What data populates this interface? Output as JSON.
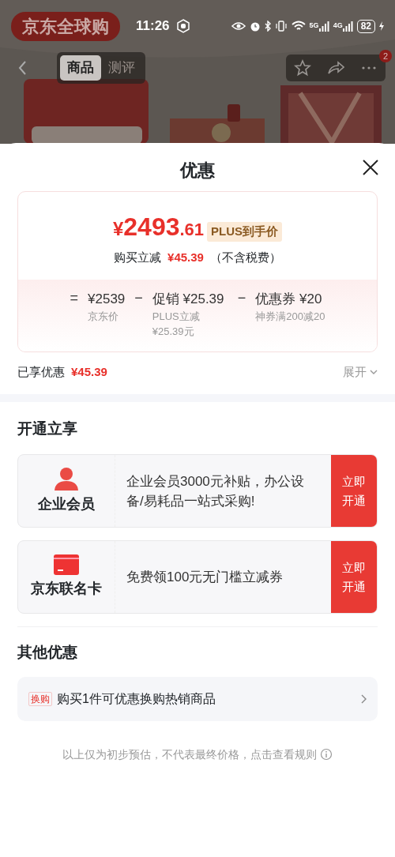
{
  "status_bar": {
    "time": "11:26",
    "network_1": "5G",
    "network_2": "4G",
    "battery": "82"
  },
  "product_page": {
    "badge": "京东全球购",
    "tabs": [
      {
        "label": "商品",
        "selected": true
      },
      {
        "label": "测评",
        "selected": false
      }
    ],
    "notification_count": "2"
  },
  "sheet": {
    "title": "优惠",
    "price": {
      "currency": "¥",
      "integer": "2493",
      "decimal": ".61",
      "tag": "PLUS到手价",
      "saving_label": "购买立减",
      "saving": "¥45.39",
      "note": "（不含税费）"
    },
    "breakdown": [
      {
        "operator": "=",
        "amount": "¥2539",
        "caption": "京东价"
      },
      {
        "operator": "−",
        "amount": "促销 ¥25.39",
        "caption": "PLUS立减¥25.39元"
      },
      {
        "operator": "−",
        "amount": "优惠券 ¥20",
        "caption": "神券满200减20"
      }
    ],
    "enjoyed_label": "已享优惠",
    "enjoyed": "¥45.39",
    "expand": "展开"
  },
  "membership": {
    "heading": "开通立享",
    "offers": [
      {
        "kind": "member",
        "name": "企业会员",
        "text": "企业会员3000元补贴，办公设备/易耗品一站式采购!",
        "action": "立即开通"
      },
      {
        "kind": "card",
        "name": "京东联名卡",
        "text": "免费领100元无门槛立减券",
        "action": "立即开通"
      }
    ]
  },
  "other": {
    "heading": "其他优惠",
    "items": [
      {
        "tag": "换购",
        "text": "购买1件可优惠换购热销商品"
      }
    ]
  },
  "footer": "以上仅为初步预估，不代表最终价格，点击查看规则"
}
